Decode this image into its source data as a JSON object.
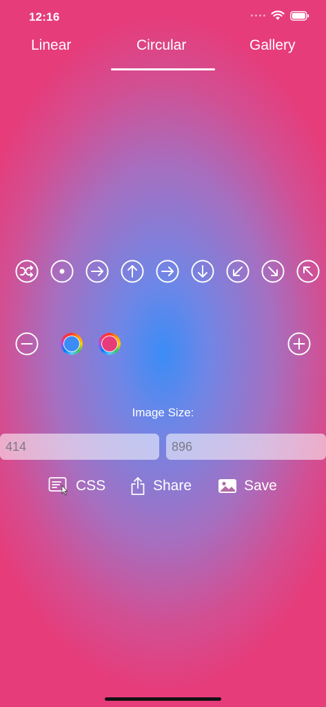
{
  "status_bar": {
    "time": "12:16",
    "icons": [
      "signal-icon",
      "wifi-icon",
      "battery-icon"
    ]
  },
  "tabs": [
    {
      "label": "Linear",
      "selected": false
    },
    {
      "label": "Circular",
      "selected": true
    },
    {
      "label": "Gallery",
      "selected": false
    }
  ],
  "position_icons": [
    "shuffle-icon",
    "center-dot-icon",
    "arrow-right-icon",
    "arrow-up-icon",
    "arrow-right-icon",
    "arrow-down-icon",
    "arrow-down-left-icon",
    "arrow-down-right-icon",
    "arrow-up-left-icon"
  ],
  "colors": {
    "stop_1": "#3b8cf6",
    "stop_2": "#e63c7a"
  },
  "image_size": {
    "label": "Image Size:",
    "width": "414",
    "height": "896"
  },
  "actions": [
    {
      "label": "CSS",
      "icon": "css-code-icon"
    },
    {
      "label": "Share",
      "icon": "share-icon"
    },
    {
      "label": "Save",
      "icon": "photo-icon"
    }
  ]
}
